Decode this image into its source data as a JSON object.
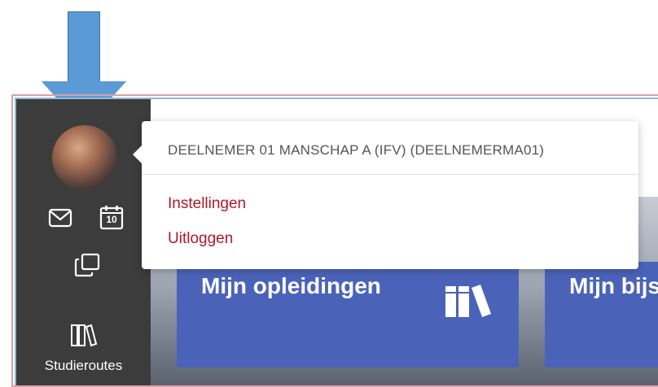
{
  "user": {
    "name": "DEELNEMER 01 MANSCHAP A (IFV) (DEELNEMERMA01)"
  },
  "menu": {
    "items": [
      {
        "label": "Instellingen"
      },
      {
        "label": "Uitloggen"
      }
    ]
  },
  "sidebar": {
    "studieroutes_label": "Studieroutes",
    "calendar_day": "10"
  },
  "tiles": [
    {
      "title": "Mijn opleidingen"
    },
    {
      "title": "Mijn bijs"
    }
  ],
  "colors": {
    "sidebar": "#3c3c3c",
    "tile": "#4a63b8",
    "menu_link": "#b0182a",
    "arrow": "#5b9bd5"
  }
}
